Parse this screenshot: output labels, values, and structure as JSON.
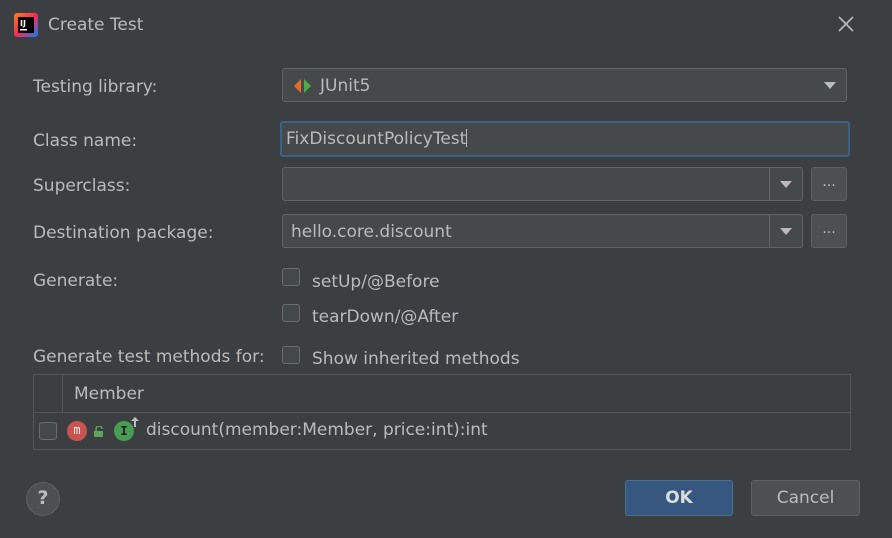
{
  "window": {
    "title": "Create Test",
    "app_icon": "intellij-idea-icon",
    "close_icon": "close-icon"
  },
  "form": {
    "testing_library": {
      "label": "Testing library:",
      "value": "JUnit5",
      "icon": "junit5-icon"
    },
    "class_name": {
      "label": "Class name:",
      "value": "FixDiscountPolicyTest"
    },
    "superclass": {
      "label": "Superclass:",
      "value": "",
      "browse_label": "..."
    },
    "destination_package": {
      "label": "Destination package:",
      "value": "hello.core.discount",
      "browse_label": "..."
    },
    "generate": {
      "label": "Generate:",
      "options": [
        {
          "label": "setUp/@Before",
          "checked": false
        },
        {
          "label": "tearDown/@After",
          "checked": false
        }
      ]
    },
    "generate_methods_for": {
      "label": "Generate test methods for:",
      "show_inherited": {
        "label": "Show inherited methods",
        "checked": false
      }
    }
  },
  "members_table": {
    "column_header": "Member",
    "rows": [
      {
        "checked": false,
        "method_icon_letter": "m",
        "implements_icon_letter": "I",
        "label": "discount(member:Member, price:int):int"
      }
    ]
  },
  "footer": {
    "help_label": "?",
    "ok_label": "OK",
    "cancel_label": "Cancel"
  },
  "colors": {
    "background": "#3c3f41",
    "accent": "#365880",
    "focus_border": "#3d6185",
    "method_badge": "#c75450",
    "implements_badge": "#499c54"
  }
}
